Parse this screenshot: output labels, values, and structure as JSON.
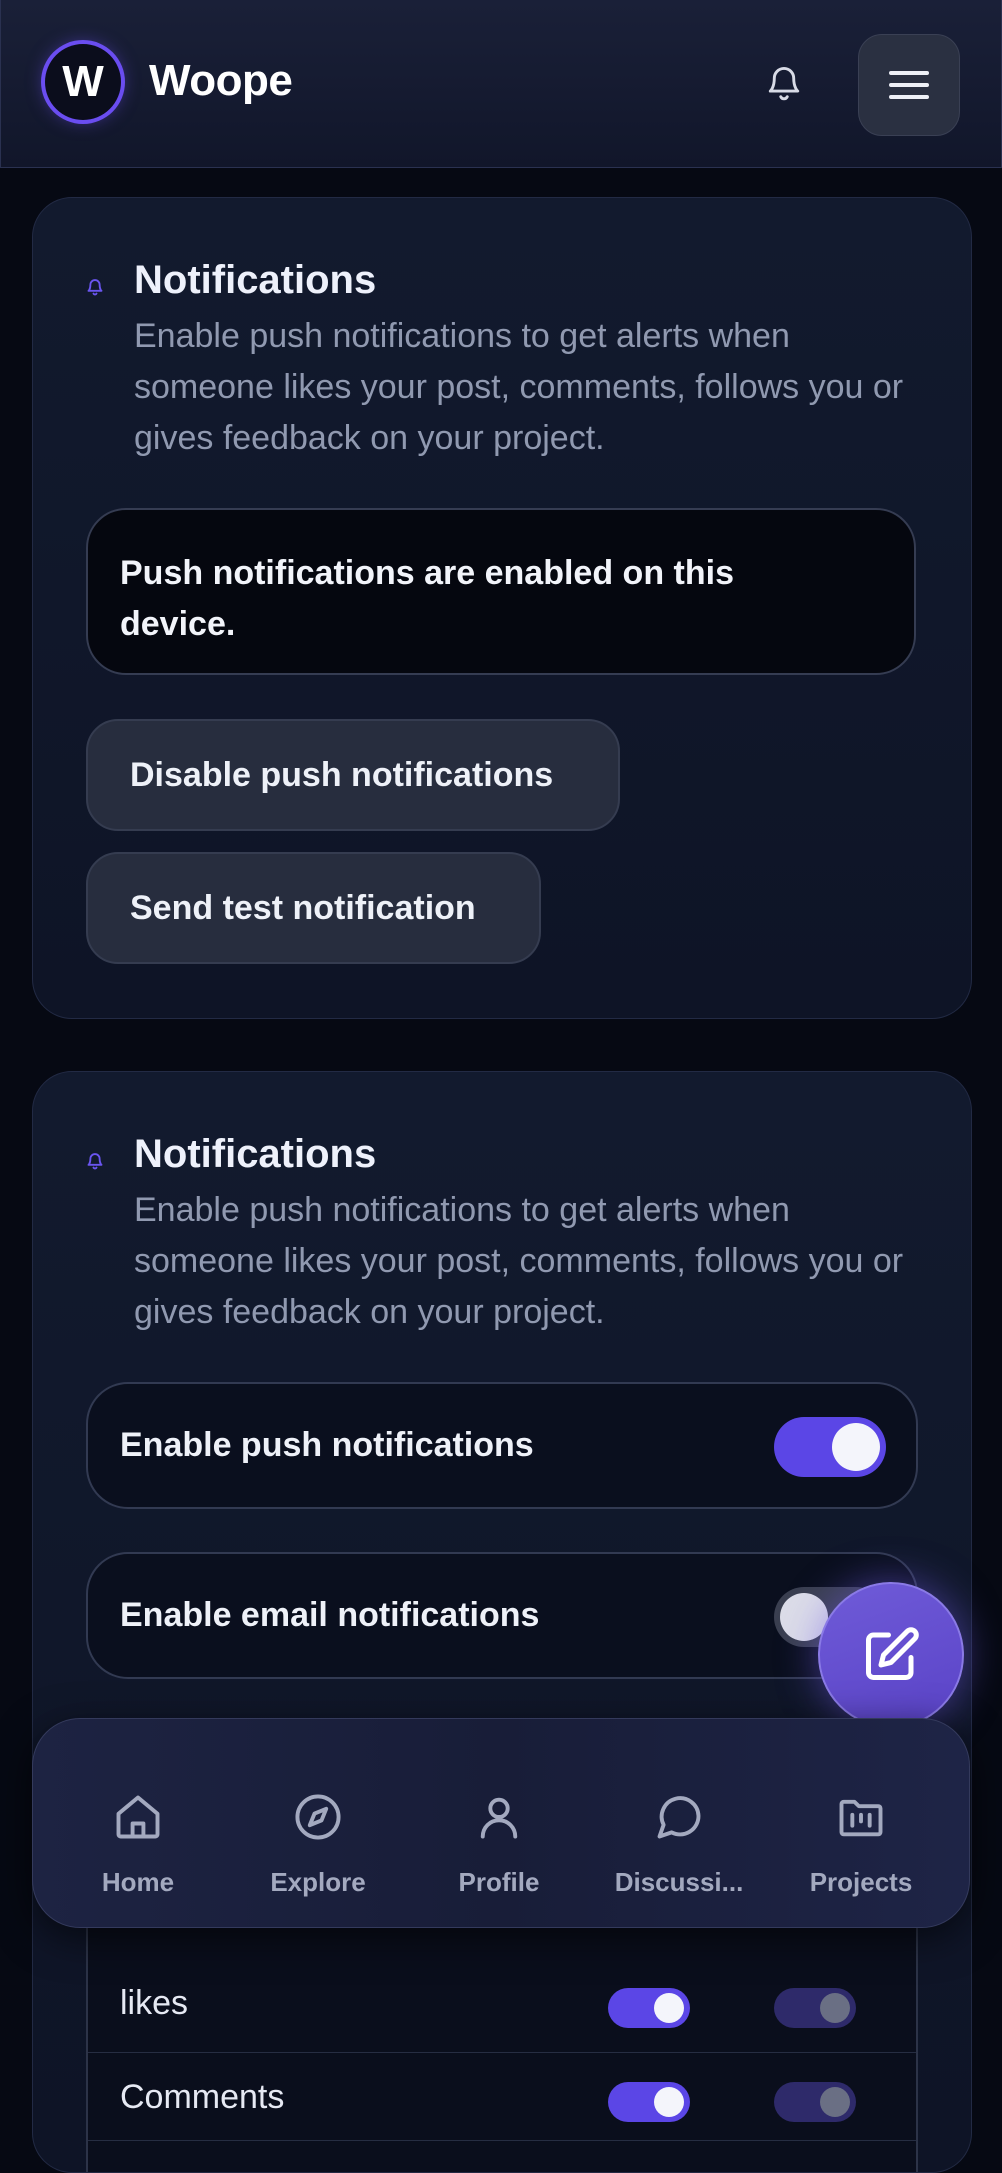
{
  "header": {
    "brand": "Woope",
    "logo_letter": "W",
    "icons": {
      "notifications": "bell-icon",
      "menu": "hamburger-menu-icon"
    }
  },
  "push_card": {
    "title": "Notifications",
    "description": "Enable push notifications to get alerts when someone likes your post, comments, follows you or gives feedback on your project.",
    "status": "Push notifications are enabled on this device.",
    "disable_button": "Disable push notifications",
    "test_button": "Send test notification"
  },
  "settings_card": {
    "title": "Notifications",
    "description": "Enable push notifications to get alerts when someone likes your post, comments, follows you or gives feedback on your project.",
    "toggles": [
      {
        "label": "Enable push notifications",
        "on": true
      },
      {
        "label": "Enable email notifications",
        "on": false
      }
    ],
    "preferences": [
      {
        "label": "likes"
      },
      {
        "label": "Comments"
      }
    ]
  },
  "nav": {
    "items": [
      {
        "label": "Home",
        "icon": "home-icon"
      },
      {
        "label": "Explore",
        "icon": "compass-icon"
      },
      {
        "label": "Profile",
        "icon": "user-icon"
      },
      {
        "label": "Discussi...",
        "icon": "chat-bubble-icon"
      },
      {
        "label": "Projects",
        "icon": "folder-icon"
      }
    ]
  },
  "fab": {
    "icon": "edit-icon"
  },
  "colors": {
    "accent": "#5b46e6",
    "background": "#060913",
    "muted_text": "#9099b0"
  }
}
